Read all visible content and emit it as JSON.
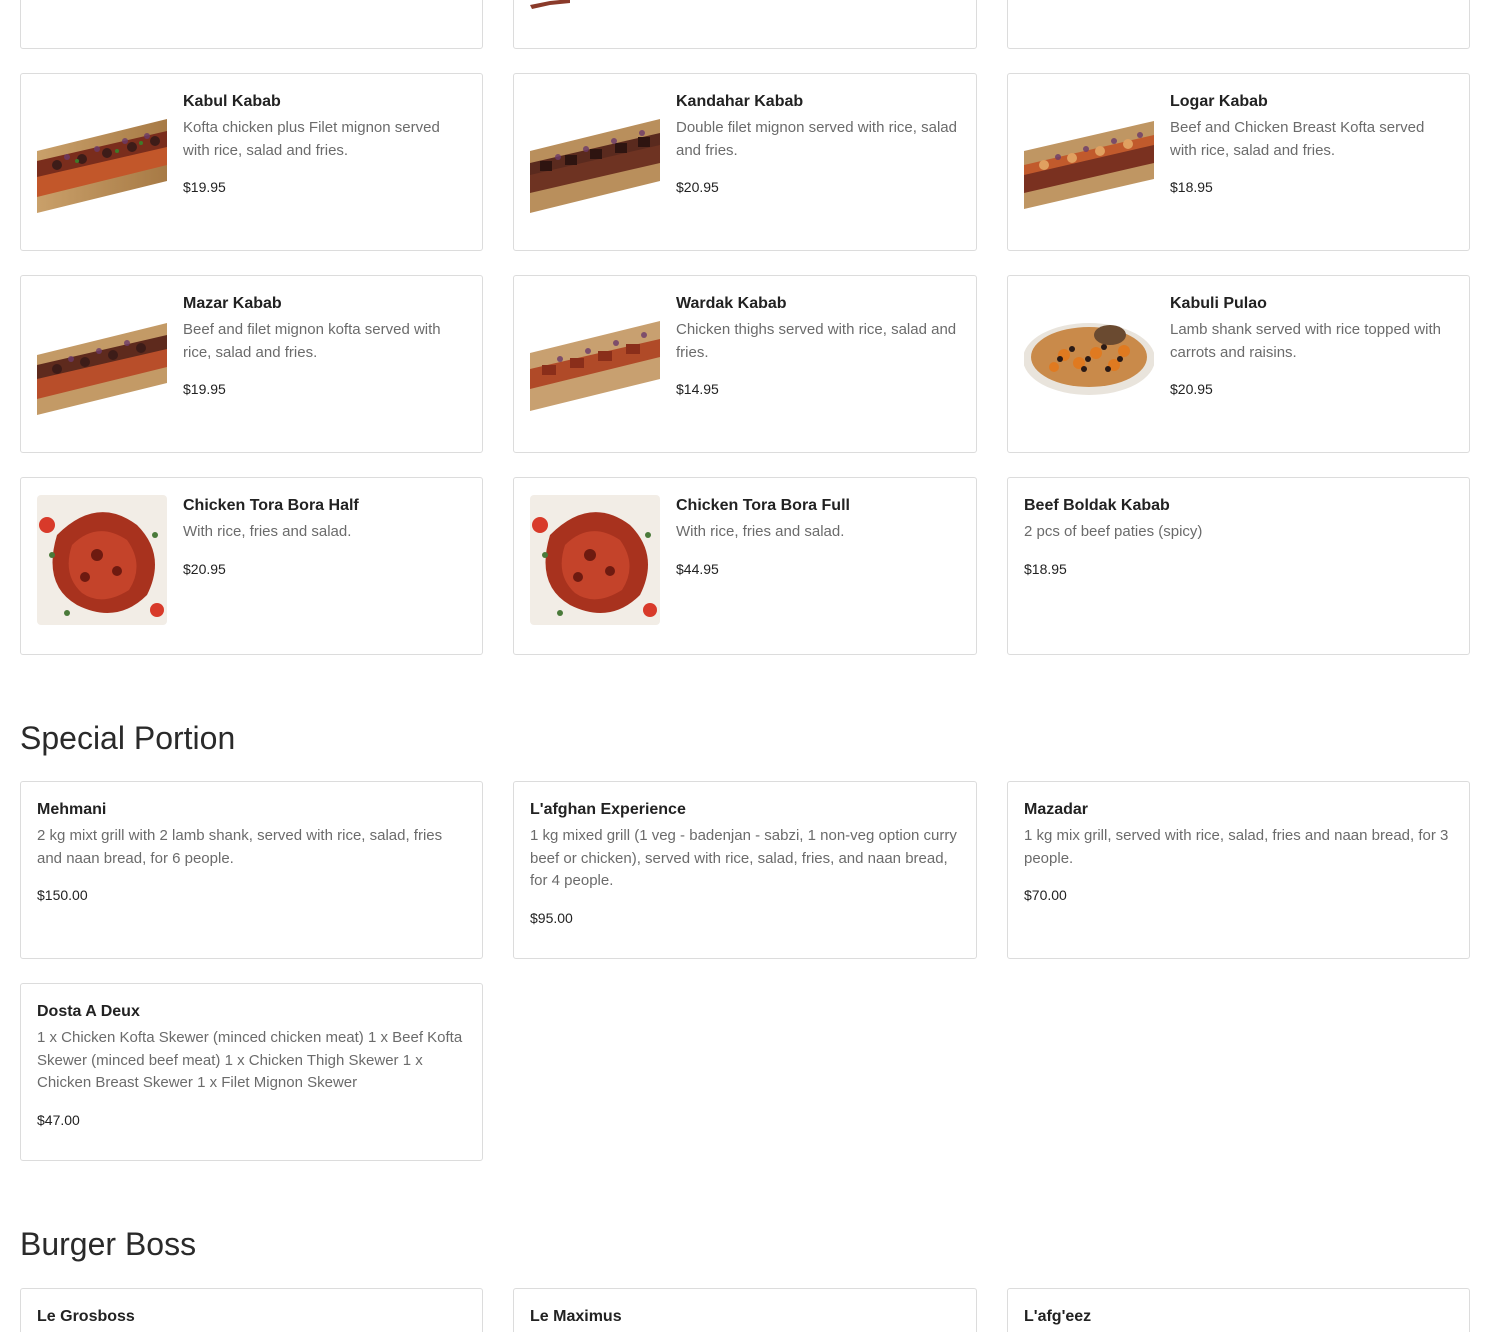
{
  "kabab_rows": [
    [
      {
        "title": "Kabul Kabab",
        "desc": "Kofta chicken plus Filet mignon served with rice, salad and fries.",
        "price": "$19.95",
        "image": "kabab-platter"
      },
      {
        "title": "Kandahar Kabab",
        "desc": "Double filet mignon served with rice, salad and fries.",
        "price": "$20.95",
        "image": "kabab-platter"
      },
      {
        "title": "Logar Kabab",
        "desc": "Beef and Chicken Breast Kofta served with rice, salad and fries.",
        "price": "$18.95",
        "image": "kabab-platter"
      }
    ],
    [
      {
        "title": "Mazar Kabab",
        "desc": "Beef and filet mignon kofta served with rice, salad and fries.",
        "price": "$19.95",
        "image": "kabab-platter"
      },
      {
        "title": "Wardak Kabab",
        "desc": "Chicken thighs served with rice, salad and fries.",
        "price": "$14.95",
        "image": "kabab-platter"
      },
      {
        "title": "Kabuli Pulao",
        "desc": "Lamb shank served with rice topped with carrots and raisins.",
        "price": "$20.95",
        "image": "pulao-plate"
      }
    ],
    [
      {
        "title": "Chicken Tora Bora Half",
        "desc": "With rice, fries and salad.",
        "price": "$20.95",
        "image": "roast-chicken"
      },
      {
        "title": "Chicken Tora Bora Full",
        "desc": "With rice, fries and salad.",
        "price": "$44.95",
        "image": "roast-chicken"
      },
      {
        "title": "Beef Boldak Kabab",
        "desc": "2 pcs of beef paties (spicy)",
        "price": "$18.95",
        "image": ""
      }
    ]
  ],
  "special": {
    "heading": "Special Portion",
    "items": [
      {
        "title": "Mehmani",
        "desc": "2 kg mixt grill with 2 lamb shank, served with rice, salad, fries and naan bread, for 6 people.",
        "price": "$150.00"
      },
      {
        "title": "L'afghan Experience",
        "desc": "1 kg mixed grill (1 veg - badenjan - sabzi, 1 non-veg option curry beef or chicken), served with rice, salad, fries, and naan bread, for 4 people.",
        "price": "$95.00"
      },
      {
        "title": "Mazadar",
        "desc": "1 kg mix grill, served with rice, salad, fries and naan bread, for 3 people.",
        "price": "$70.00"
      },
      {
        "title": "Dosta A Deux",
        "desc": "1 x Chicken Kofta Skewer (minced chicken meat) 1 x Beef Kofta Skewer (minced beef meat) 1 x Chicken Thigh Skewer 1 x Chicken Breast Skewer 1 x Filet Mignon Skewer",
        "price": "$47.00"
      }
    ]
  },
  "burger": {
    "heading": "Burger Boss",
    "items": [
      {
        "title": "Le Grosboss"
      },
      {
        "title": "Le Maximus"
      },
      {
        "title": "L'afg'eez"
      }
    ]
  },
  "colors": {
    "border": "#dcdcdc",
    "desc_text": "#6b6b6b",
    "title_text": "#222222"
  }
}
